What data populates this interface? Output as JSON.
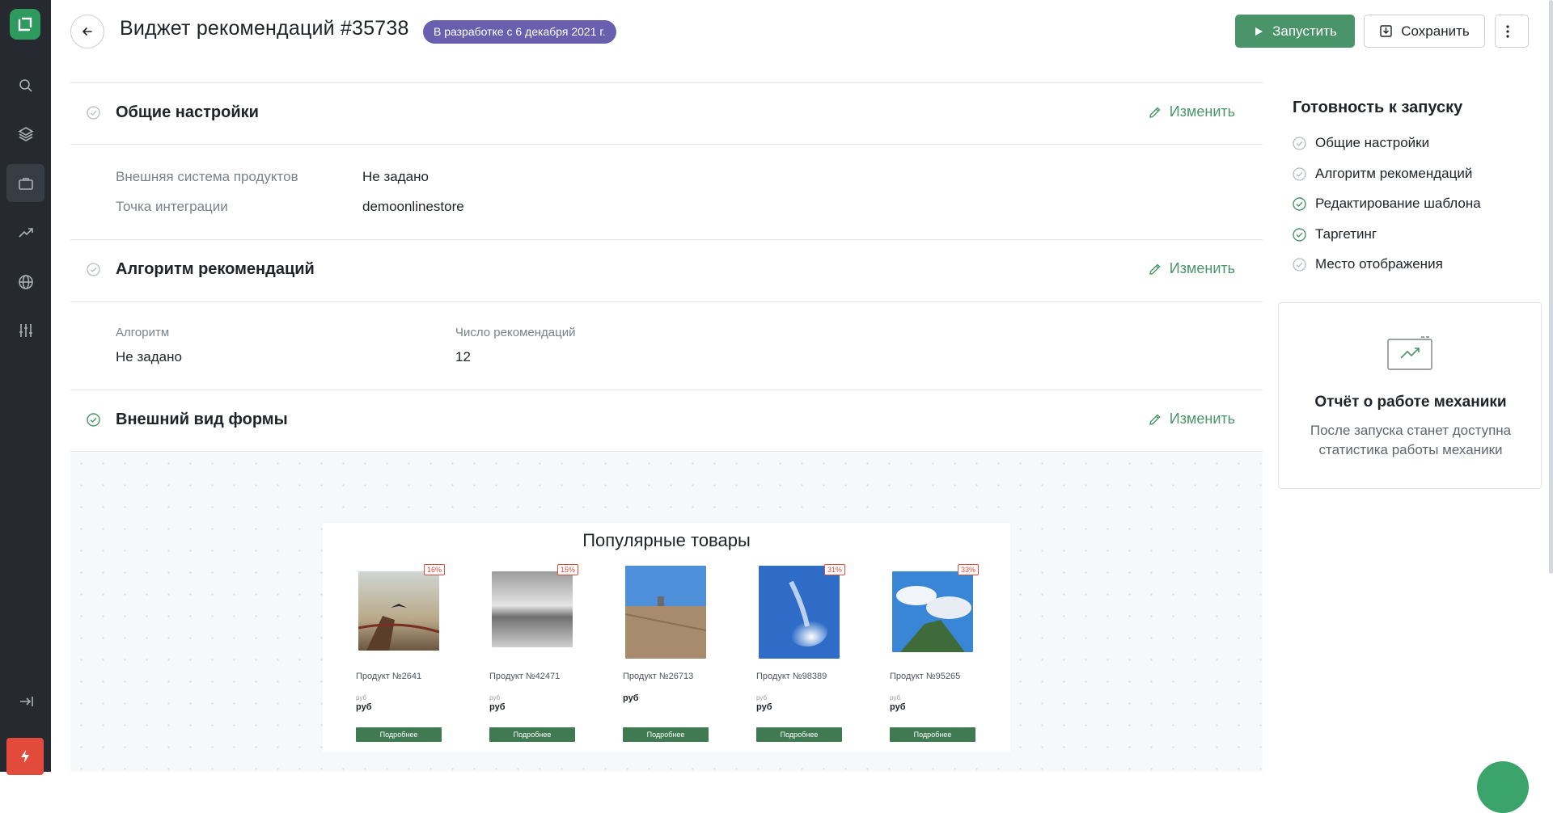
{
  "header": {
    "title": "Виджет рекомендаций #35738",
    "status_badge": "В разработке с 6 декабря 2021 г.",
    "run_label": "Запустить",
    "save_label": "Сохранить"
  },
  "sections": {
    "general": {
      "title": "Общие настройки",
      "edit_label": "Изменить",
      "fields": [
        {
          "label": "Внешняя система продуктов",
          "value": "Не задано"
        },
        {
          "label": "Точка интеграции",
          "value": "demoonlinestore"
        }
      ]
    },
    "algorithm": {
      "title": "Алгоритм рекомендаций",
      "edit_label": "Изменить",
      "fields": [
        {
          "label": "Алгоритм",
          "value": "Не задано"
        },
        {
          "label": "Число рекомендаций",
          "value": "12"
        }
      ]
    },
    "appearance": {
      "title": "Внешний вид формы",
      "edit_label": "Изменить"
    }
  },
  "widget_preview": {
    "title": "Популярные товары",
    "products": [
      {
        "name": "Продукт №2641",
        "discount": "16%",
        "currency_small": "руб",
        "currency": "руб",
        "button": "Подробнее"
      },
      {
        "name": "Продукт №42471",
        "discount": "15%",
        "currency_small": "руб",
        "currency": "руб",
        "button": "Подробнее"
      },
      {
        "name": "Продукт №26713",
        "discount": "",
        "currency_small": "",
        "currency": "руб",
        "button": "Подробнее"
      },
      {
        "name": "Продукт №98389",
        "discount": "31%",
        "currency_small": "руб",
        "currency": "руб",
        "button": "Подробнее"
      },
      {
        "name": "Продукт №95265",
        "discount": "33%",
        "currency_small": "руб",
        "currency": "руб",
        "button": "Подробнее"
      }
    ]
  },
  "readiness": {
    "title": "Готовность к запуску",
    "items": [
      {
        "label": "Общие настройки",
        "done": false
      },
      {
        "label": "Алгоритм рекомендаций",
        "done": false
      },
      {
        "label": "Редактирование шаблона",
        "done": true
      },
      {
        "label": "Таргетинг",
        "done": true
      },
      {
        "label": "Место отображения",
        "done": false
      }
    ]
  },
  "report": {
    "title": "Отчёт о работе механики",
    "description": "После запуска станет доступна статистика работы механики"
  },
  "colors": {
    "accent_green": "#4a9469",
    "badge_purple": "#6a5fae",
    "sidebar": "#262a30",
    "danger": "#e24a3b"
  }
}
